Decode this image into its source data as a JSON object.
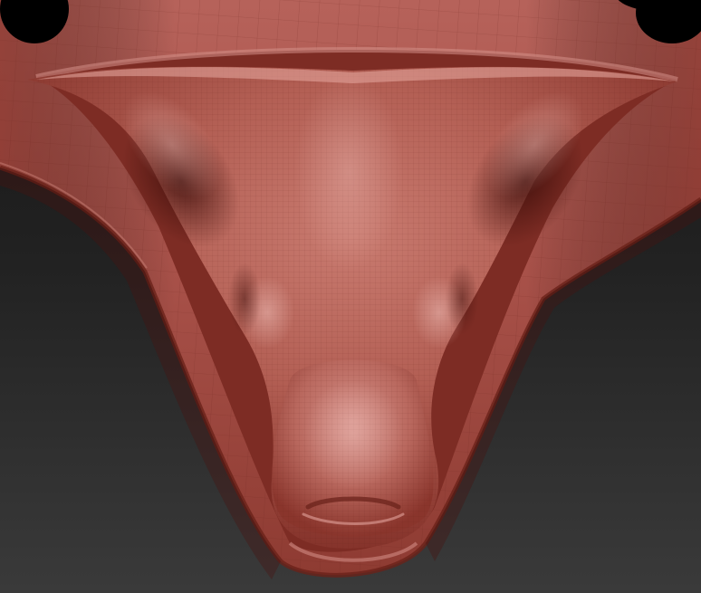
{
  "scene": {
    "background_top_color": "#161616",
    "background_bottom_color": "#3a3a3a",
    "material_color": "#b2584c",
    "material_highlight_color": "#d78d84",
    "material_shadow_color": "#5e1e18",
    "hole_color": "#000000"
  }
}
